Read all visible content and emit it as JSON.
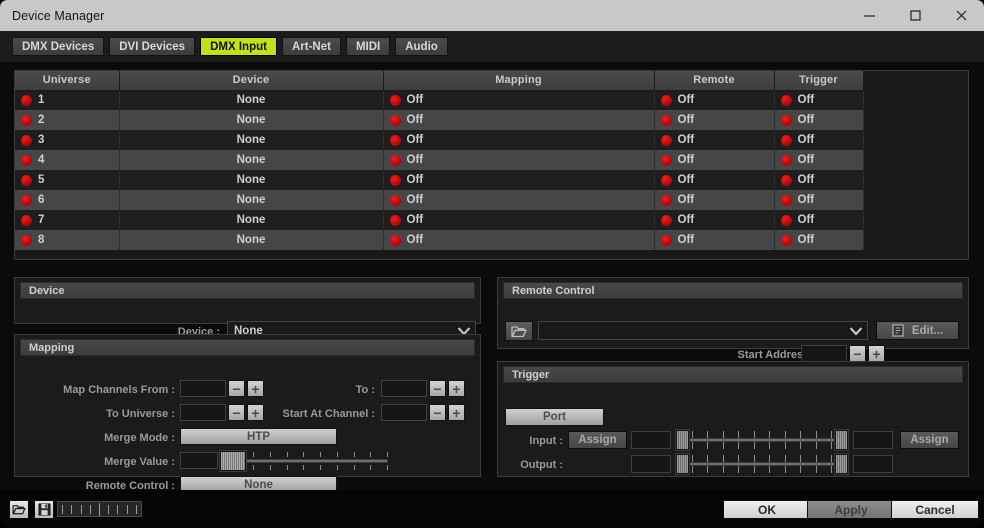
{
  "window": {
    "title": "Device Manager",
    "minimize_label": "Minimize",
    "maximize_label": "Maximize",
    "close_label": "Close"
  },
  "tabs": [
    {
      "label": "DMX Devices",
      "active": false
    },
    {
      "label": "DVI Devices",
      "active": false
    },
    {
      "label": "DMX Input",
      "active": true
    },
    {
      "label": "Art-Net",
      "active": false
    },
    {
      "label": "MIDI",
      "active": false
    },
    {
      "label": "Audio",
      "active": false
    }
  ],
  "table": {
    "columns": [
      "Universe",
      "Device",
      "Mapping",
      "Remote",
      "Trigger"
    ],
    "rows": [
      {
        "universe": "1",
        "device": "None",
        "mapping": "Off",
        "remote": "Off",
        "trigger": "Off"
      },
      {
        "universe": "2",
        "device": "None",
        "mapping": "Off",
        "remote": "Off",
        "trigger": "Off"
      },
      {
        "universe": "3",
        "device": "None",
        "mapping": "Off",
        "remote": "Off",
        "trigger": "Off"
      },
      {
        "universe": "4",
        "device": "None",
        "mapping": "Off",
        "remote": "Off",
        "trigger": "Off"
      },
      {
        "universe": "5",
        "device": "None",
        "mapping": "Off",
        "remote": "Off",
        "trigger": "Off"
      },
      {
        "universe": "6",
        "device": "None",
        "mapping": "Off",
        "remote": "Off",
        "trigger": "Off"
      },
      {
        "universe": "7",
        "device": "None",
        "mapping": "Off",
        "remote": "Off",
        "trigger": "Off"
      },
      {
        "universe": "8",
        "device": "None",
        "mapping": "Off",
        "remote": "Off",
        "trigger": "Off"
      }
    ],
    "monitor_button": "monitor-icon"
  },
  "device_panel": {
    "title": "Device",
    "device_label": "Device :",
    "device_value": "None"
  },
  "mapping_panel": {
    "title": "Mapping",
    "map_channels_from_label": "Map Channels From :",
    "map_channels_from_value": "",
    "to_label": "To :",
    "to_value": "",
    "to_universe_label": "To Universe :",
    "to_universe_value": "",
    "start_at_channel_label": "Start At Channel :",
    "start_at_channel_value": "",
    "merge_mode_label": "Merge Mode :",
    "merge_mode_value": "HTP",
    "merge_value_label": "Merge Value :",
    "merge_value_value": "",
    "remote_control_label": "Remote Control :",
    "remote_control_value": "None",
    "minus_label": "−",
    "plus_label": "+"
  },
  "remote_panel": {
    "title": "Remote Control",
    "open_icon": "folder-open-icon",
    "combo_value": "",
    "edit_label": "Edit...",
    "edit_icon": "document-icon",
    "start_address_label": "Start Address :",
    "start_address_value": "",
    "minus_label": "−",
    "plus_label": "+"
  },
  "trigger_panel": {
    "title": "Trigger",
    "port_label": "Port",
    "input_label": "Input :",
    "input_assign_label": "Assign",
    "input_min_value": "",
    "input_max_value": "",
    "input_assign_right_label": "Assign",
    "output_label": "Output :",
    "output_min_value": "",
    "output_max_value": ""
  },
  "footer": {
    "open_icon": "folder-open-icon",
    "save_icon": "save-icon",
    "ok_label": "OK",
    "apply_label": "Apply",
    "cancel_label": "Cancel"
  },
  "colors": {
    "accent": "#c2e215",
    "led_off": "#c10707",
    "titlebar": "#c8c8c8"
  }
}
